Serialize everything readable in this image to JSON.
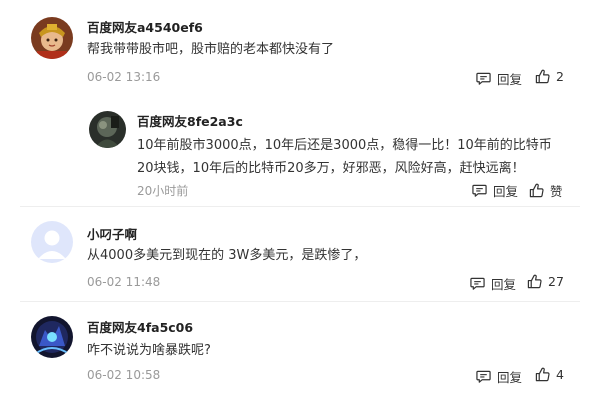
{
  "comments": [
    {
      "username": "百度网友a4540ef6",
      "content": "帮我带带股市吧，股市赔的老本都快没有了",
      "time": "06-02 13:16",
      "reply_label": "回复",
      "like_count": "2",
      "reply": {
        "username": "百度网友8fe2a3c",
        "content": "10年前股市3000点，10年后还是3000点，稳得一比！10年前的比特币20块钱，10年后的比特币20多万，好邪恶，风险好高，赶快远离！",
        "time": "20小时前",
        "reply_label": "回复",
        "like_label": "赞"
      }
    },
    {
      "username": "小叼子啊",
      "content": "从4000多美元到现在的 3W多美元，是跌惨了，",
      "time": "06-02 11:48",
      "reply_label": "回复",
      "like_count": "27"
    },
    {
      "username": "百度网友4fa5c06",
      "content": "咋不说说为啥暴跌呢?",
      "time": "06-02 10:58",
      "reply_label": "回复",
      "like_count": "4"
    }
  ],
  "icons": {
    "reply": "comment-bubble-icon",
    "like": "thumbs-up-icon"
  },
  "colors": {
    "text": "#222222",
    "muted": "#9a9a9a",
    "divider": "#eeeeee"
  }
}
